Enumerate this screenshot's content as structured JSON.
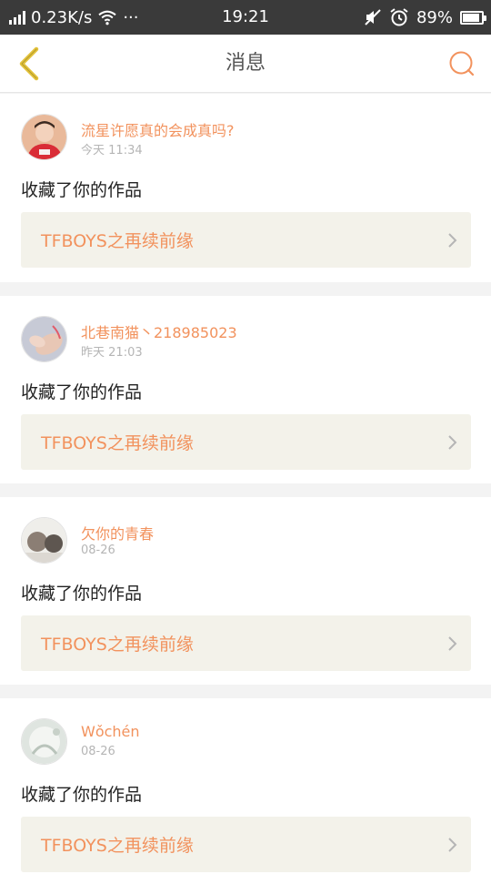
{
  "status": {
    "network_speed": "0.23K/s",
    "dots": "···",
    "time": "19:21",
    "battery": "89%"
  },
  "nav": {
    "title": "消息"
  },
  "messages": [
    {
      "username": "流星许愿真的会成真吗?",
      "day": "今天",
      "time": "11:34",
      "action": "收藏了你的作品",
      "work_title": "TFBOYS之再续前缘"
    },
    {
      "username": "北巷南猫丶218985023",
      "day": "昨天",
      "time": "21:03",
      "action": "收藏了你的作品",
      "work_title": "TFBOYS之再续前缘"
    },
    {
      "username": "欠你的青春",
      "day": "",
      "time": "08-26",
      "action": "收藏了你的作品",
      "work_title": "TFBOYS之再续前缘"
    },
    {
      "username": "Wǒchén",
      "day": "",
      "time": "08-26",
      "action": "收藏了你的作品",
      "work_title": "TFBOYS之再续前缘"
    }
  ],
  "colors": {
    "accent": "#f2925d",
    "back_icon": "#e3c23a",
    "statusbar": "#3a3a3a",
    "work_box_bg": "#f3f2ea"
  }
}
